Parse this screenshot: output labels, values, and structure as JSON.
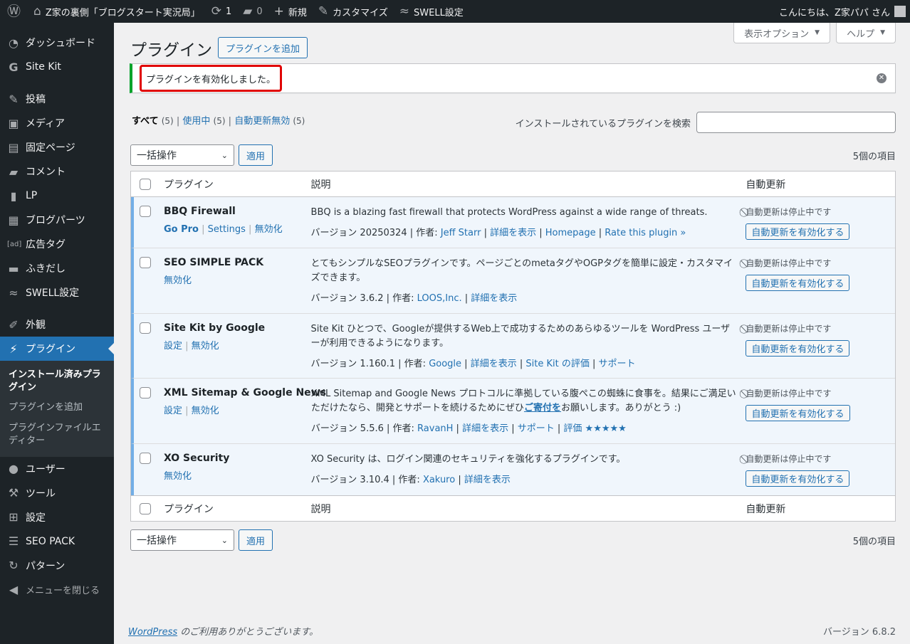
{
  "adminbar": {
    "site_name": "Z家の裏側「ブログスタート実況局」",
    "updates_count": "1",
    "comments_count": "0",
    "new_label": "新規",
    "customize_label": "カスタマイズ",
    "swell_label": "SWELL設定",
    "greeting": "こんにちは、Z家パパ さん"
  },
  "menu": {
    "items": [
      {
        "label": "ダッシュボード",
        "icon": "dashboard-icon"
      },
      {
        "label": "Site Kit",
        "icon": "google-g-icon"
      },
      {
        "label": "投稿",
        "icon": "pin-icon"
      },
      {
        "label": "メディア",
        "icon": "media-icon"
      },
      {
        "label": "固定ページ",
        "icon": "page-icon"
      },
      {
        "label": "コメント",
        "icon": "comment-icon"
      },
      {
        "label": "LP",
        "icon": "document-icon"
      },
      {
        "label": "ブログパーツ",
        "icon": "blog-parts-icon"
      },
      {
        "label": "広告タグ",
        "icon": "ad-tag-icon"
      },
      {
        "label": "ふきだし",
        "icon": "balloon-icon"
      },
      {
        "label": "SWELL設定",
        "icon": "swell-icon"
      },
      {
        "label": "外観",
        "icon": "paintbrush-icon"
      },
      {
        "label": "プラグイン",
        "icon": "plugin-icon"
      },
      {
        "label": "ユーザー",
        "icon": "user-icon"
      },
      {
        "label": "ツール",
        "icon": "wrench-icon"
      },
      {
        "label": "設定",
        "icon": "settings-icon"
      },
      {
        "label": "SEO PACK",
        "icon": "list-icon"
      },
      {
        "label": "パターン",
        "icon": "pattern-icon"
      },
      {
        "label": "メニューを閉じる",
        "icon": "collapse-icon"
      }
    ],
    "submenu": [
      "インストール済みプラグイン",
      "プラグインを追加",
      "プラグインファイルエディター"
    ]
  },
  "screen_meta": {
    "display_options": "表示オプション",
    "help": "ヘルプ"
  },
  "page": {
    "title": "プラグイン",
    "add_new": "プラグインを追加",
    "notice": "プラグインを有効化しました。"
  },
  "filters": {
    "all": "すべて",
    "all_count": "(5)",
    "active": "使用中",
    "active_count": "(5)",
    "auto_disabled": "自動更新無効",
    "auto_disabled_count": "(5)"
  },
  "search": {
    "label": "インストールされているプラグインを検索",
    "value": ""
  },
  "tablenav": {
    "bulk": "一括操作",
    "apply": "適用",
    "count": "5個の項目"
  },
  "table": {
    "col_plugin": "プラグイン",
    "col_desc": "説明",
    "col_auto": "自動更新",
    "auto_status": "自動更新は停止中です",
    "auto_button": "自動更新を有効化する",
    "rows": [
      {
        "name": "BBQ Firewall",
        "actions": [
          "Go Pro",
          "Settings",
          "無効化"
        ],
        "desc": "BBQ is a blazing fast firewall that protects WordPress against a wide range of threats.",
        "version_prefix": "バージョン 20250324 | 作者: ",
        "author": "Jeff Starr",
        "links": [
          "詳細を表示",
          "Homepage",
          "Rate this plugin »"
        ]
      },
      {
        "name": "SEO SIMPLE PACK",
        "actions": [
          "無効化"
        ],
        "desc": "とてもシンプルなSEOプラグインです。ページごとのmetaタグやOGPタグを簡単に設定・カスタマイズできます。",
        "version_prefix": "バージョン 3.6.2 | 作者: ",
        "author": "LOOS,Inc.",
        "links": [
          "詳細を表示"
        ]
      },
      {
        "name": "Site Kit by Google",
        "actions": [
          "設定",
          "無効化"
        ],
        "desc": "Site Kit ひとつで、Googleが提供するWeb上で成功するためのあらゆるツールを WordPress ユーザーが利用できるようになります。",
        "version_prefix": "バージョン 1.160.1 | 作者: ",
        "author": "Google",
        "links": [
          "詳細を表示",
          "Site Kit の評価",
          "サポート"
        ]
      },
      {
        "name": "XML Sitemap & Google News",
        "actions": [
          "設定",
          "無効化"
        ],
        "desc": "XML Sitemap and Google News プロトコルに準拠している腹ぺこの蜘蛛に食事を。結果にご満足いただけたなら、開発とサポートを続けるためにぜひ",
        "desc_link": "ご寄付を",
        "desc_after": "お願いします。ありがとう :)",
        "version_prefix": "バージョン 5.5.6 | 作者: ",
        "author": "RavanH",
        "links": [
          "詳細を表示",
          "サポート",
          "評価 ★★★★★"
        ]
      },
      {
        "name": "XO Security",
        "actions": [
          "無効化"
        ],
        "desc": "XO Security は、ログイン関連のセキュリティを強化するプラグインです。",
        "version_prefix": "バージョン 3.10.4 | 作者: ",
        "author": "Xakuro",
        "links": [
          "詳細を表示"
        ]
      }
    ]
  },
  "footer": {
    "wp_link": "WordPress",
    "thanks": " のご利用ありがとうございます。",
    "version": "バージョン 6.8.2"
  }
}
